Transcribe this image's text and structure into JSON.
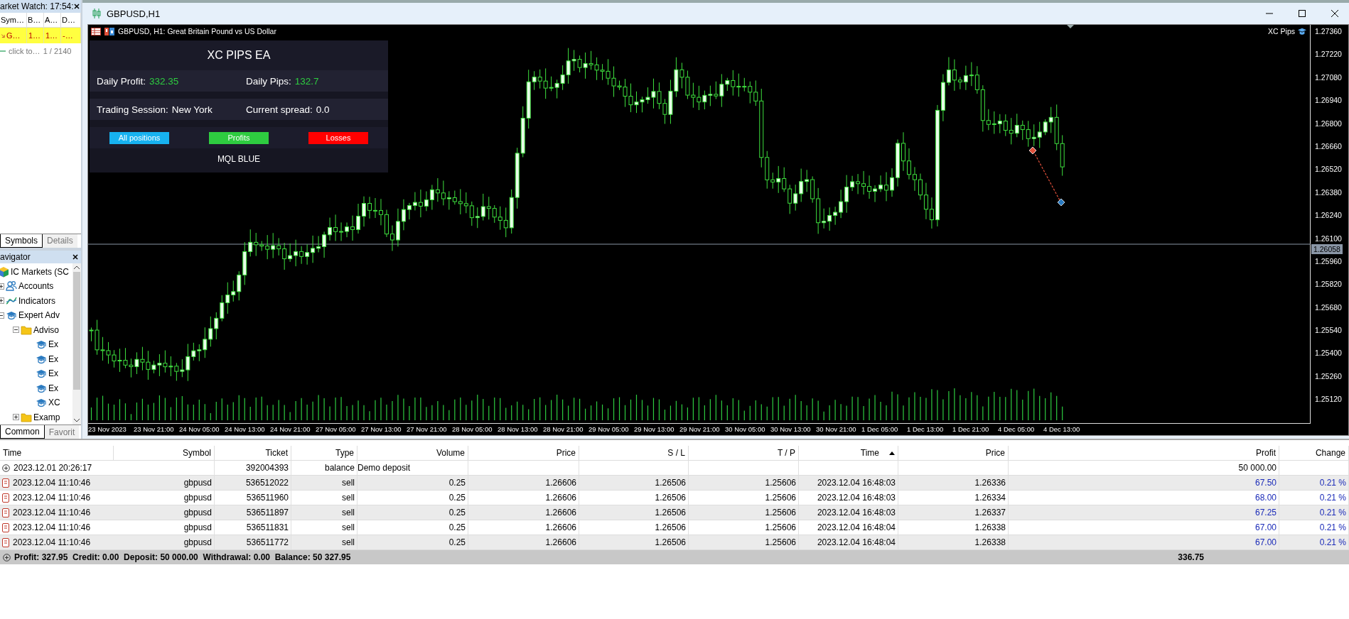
{
  "market_watch": {
    "title": "arket Watch: 17:54:",
    "columns": [
      "Sym…",
      "B…",
      "A…",
      "D…"
    ],
    "rows": [
      {
        "cells": [
          "G…",
          "1…",
          "1…",
          "-…"
        ],
        "selected": true
      }
    ],
    "add_row": {
      "label": "click to…",
      "count": "1 / 2140"
    },
    "tabs": [
      {
        "label": "Symbols",
        "selected": true
      },
      {
        "label": "Details",
        "selected": false
      }
    ]
  },
  "navigator": {
    "title": "avigator",
    "tree": [
      {
        "label": "IC Markets (SC",
        "kind": "broker"
      },
      {
        "label": "Accounts",
        "kind": "accounts",
        "expanded": false
      },
      {
        "label": "Indicators",
        "kind": "indicators",
        "expanded": false
      },
      {
        "label": "Expert Adv",
        "kind": "experts",
        "expanded": true,
        "children": [
          {
            "label": "Adviso",
            "kind": "folder",
            "expanded": true,
            "children": [
              {
                "label": "Ex",
                "kind": "expert"
              },
              {
                "label": "Ex",
                "kind": "expert"
              },
              {
                "label": "Ex",
                "kind": "expert"
              },
              {
                "label": "Ex",
                "kind": "expert"
              },
              {
                "label": "XC",
                "kind": "expert"
              }
            ]
          },
          {
            "label": "Examp",
            "kind": "folder",
            "expanded": false
          }
        ]
      }
    ],
    "tabs": [
      {
        "label": "Common",
        "selected": true
      },
      {
        "label": "Favorit",
        "selected": false
      }
    ]
  },
  "chart_window": {
    "title": "GBPUSD,H1",
    "chart": {
      "header": "GBPUSD, H1:  Great Britain Pound vs US Dollar",
      "ea_label": "XC Pips",
      "current_price": "1.26058",
      "price_ticks": [
        "1.27360",
        "1.27220",
        "1.27080",
        "1.26940",
        "1.26800",
        "1.26660",
        "1.26520",
        "1.26380",
        "1.26240",
        "1.26100",
        "1.25960",
        "1.25820",
        "1.25680",
        "1.25540",
        "1.25400",
        "1.25260",
        "1.25120"
      ],
      "time_ticks": [
        "23 Nov 2023",
        "23 Nov 21:00",
        "24 Nov 05:00",
        "24 Nov 13:00",
        "24 Nov 21:00",
        "27 Nov 05:00",
        "27 Nov 13:00",
        "27 Nov 21:00",
        "28 Nov 05:00",
        "28 Nov 13:00",
        "28 Nov 21:00",
        "29 Nov 05:00",
        "29 Nov 13:00",
        "29 Nov 21:00",
        "30 Nov 05:00",
        "30 Nov 13:00",
        "30 Nov 21:00",
        "1 Dec 05:00",
        "1 Dec 13:00",
        "1 Dec 21:00",
        "4 Dec 05:00",
        "4 Dec 13:00"
      ]
    },
    "ea_panel": {
      "title": "XC PIPS EA",
      "rows": [
        [
          {
            "label": "Daily Profit:",
            "value": "332.35",
            "highlight": true
          },
          {
            "label": "Daily Pips:",
            "value": "132.7",
            "highlight": true
          }
        ],
        [
          {
            "label": "Trading Session:",
            "value": "New York",
            "highlight": false
          },
          {
            "label": "Current spread:",
            "value": "0.0",
            "highlight": false
          }
        ]
      ],
      "buttons": [
        {
          "label": "All positions",
          "color": "#17b2f0"
        },
        {
          "label": "Profits",
          "color": "#2ecc40"
        },
        {
          "label": "Losses",
          "color": "#ff0000"
        }
      ],
      "footer": "MQL BLUE"
    }
  },
  "terminal": {
    "columns": [
      {
        "label": "Time",
        "sorted": false
      },
      {
        "label": "Symbol",
        "sorted": false
      },
      {
        "label": "Ticket",
        "sorted": false
      },
      {
        "label": "Type",
        "sorted": false
      },
      {
        "label": "Volume",
        "sorted": false
      },
      {
        "label": "Price",
        "sorted": false
      },
      {
        "label": "S / L",
        "sorted": false
      },
      {
        "label": "T / P",
        "sorted": false
      },
      {
        "label": "Time",
        "sorted": true
      },
      {
        "label": "Price",
        "sorted": false
      },
      {
        "label": "Profit",
        "sorted": false
      },
      {
        "label": "Change",
        "sorted": false
      }
    ],
    "rows": [
      {
        "kind": "balance",
        "time": "2023.12.01 20:26:17",
        "ticket": "392004393",
        "type": "balance",
        "comment": "Demo deposit",
        "profit": "50 000.00"
      },
      {
        "kind": "trade",
        "time": "2023.12.04 11:10:46",
        "symbol": "gbpusd",
        "ticket": "536512022",
        "type": "sell",
        "volume": "0.25",
        "price": "1.26606",
        "sl": "1.26506",
        "tp": "1.25606",
        "close_time": "2023.12.04 16:48:03",
        "close_price": "1.26336",
        "profit": "67.50",
        "change": "0.21 %"
      },
      {
        "kind": "trade",
        "time": "2023.12.04 11:10:46",
        "symbol": "gbpusd",
        "ticket": "536511960",
        "type": "sell",
        "volume": "0.25",
        "price": "1.26606",
        "sl": "1.26506",
        "tp": "1.25606",
        "close_time": "2023.12.04 16:48:03",
        "close_price": "1.26334",
        "profit": "68.00",
        "change": "0.21 %"
      },
      {
        "kind": "trade",
        "time": "2023.12.04 11:10:46",
        "symbol": "gbpusd",
        "ticket": "536511897",
        "type": "sell",
        "volume": "0.25",
        "price": "1.26606",
        "sl": "1.26506",
        "tp": "1.25606",
        "close_time": "2023.12.04 16:48:03",
        "close_price": "1.26337",
        "profit": "67.25",
        "change": "0.21 %"
      },
      {
        "kind": "trade",
        "time": "2023.12.04 11:10:46",
        "symbol": "gbpusd",
        "ticket": "536511831",
        "type": "sell",
        "volume": "0.25",
        "price": "1.26606",
        "sl": "1.26506",
        "tp": "1.25606",
        "close_time": "2023.12.04 16:48:04",
        "close_price": "1.26338",
        "profit": "67.00",
        "change": "0.21 %"
      },
      {
        "kind": "trade",
        "time": "2023.12.04 11:10:46",
        "symbol": "gbpusd",
        "ticket": "536511772",
        "type": "sell",
        "volume": "0.25",
        "price": "1.26606",
        "sl": "1.26506",
        "tp": "1.25606",
        "close_time": "2023.12.04 16:48:04",
        "close_price": "1.26338",
        "profit": "67.00",
        "change": "0.21 %"
      }
    ],
    "summary": {
      "text": "Profit: 327.95  Credit: 0.00  Deposit: 50 000.00  Withdrawal: 0.00  Balance: 50 327.95",
      "profit": "336.75"
    }
  }
}
